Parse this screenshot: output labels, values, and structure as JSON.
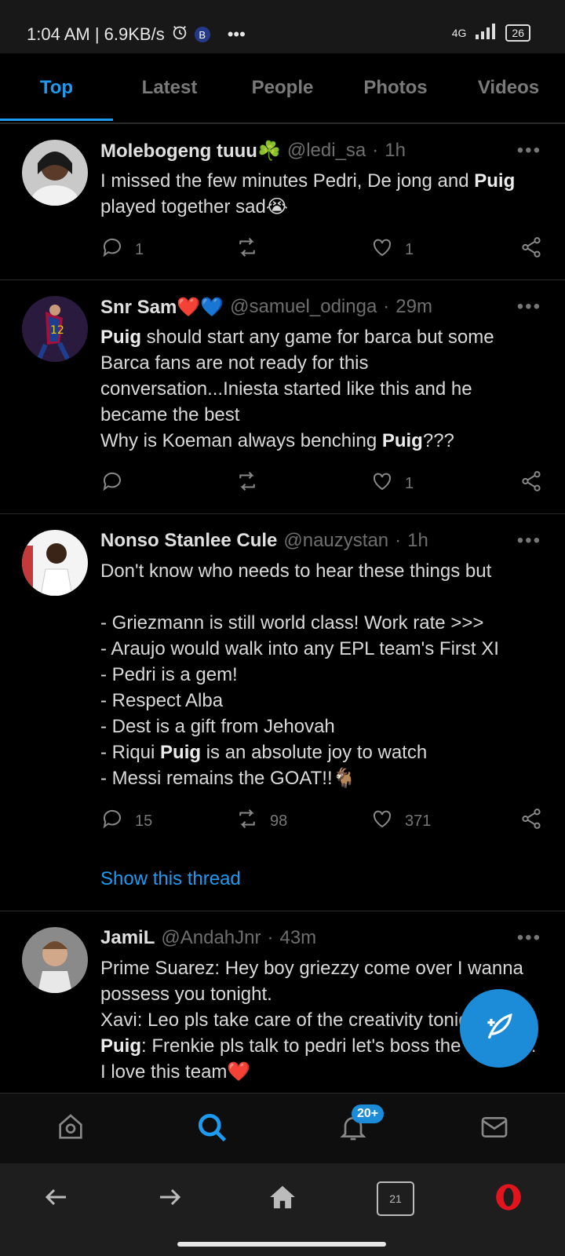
{
  "status_bar": {
    "time": "1:04 AM | 6.9KB/s",
    "more": "•••",
    "network": "4G",
    "battery": "26",
    "app_badge": "B"
  },
  "tabs": [
    {
      "label": "Top",
      "active": true
    },
    {
      "label": "Latest",
      "active": false
    },
    {
      "label": "People",
      "active": false
    },
    {
      "label": "Photos",
      "active": false
    },
    {
      "label": "Videos",
      "active": false
    }
  ],
  "tweets": [
    {
      "name": "Molebogeng tuuu☘️",
      "handle": "@ledi_sa",
      "time": "1h",
      "text_html": "I missed the few minutes Pedri, De jong and <b>Puig</b> played together sad😭",
      "replies": "1",
      "retweets": "",
      "likes": "1"
    },
    {
      "name": "Snr Sam❤️💙",
      "handle": "@samuel_odinga",
      "time": "29m",
      "text_html": "<b>Puig</b> should start any game for barca but some Barca fans are not ready for this conversation...Iniesta started like this and he became the best\nWhy is Koeman always benching <b>Puig</b>???",
      "replies": "",
      "retweets": "",
      "likes": "1"
    },
    {
      "name": "Nonso Stanlee Cule",
      "handle": "@nauzystan",
      "time": "1h",
      "text_html": "Don't know who needs to hear these things but\n\n- Griezmann is still world class! Work rate >>>\n- Araujo would walk into any EPL team's First XI\n- Pedri is a gem!\n- Respect Alba\n- Dest is a gift from Jehovah\n- Riqui <b>Puig</b> is an absolute joy to watch\n- Messi remains the GOAT!!🐐",
      "replies": "15",
      "retweets": "98",
      "likes": "371",
      "thread_link": "Show this thread"
    },
    {
      "name": "JamiL",
      "handle": "@AndahJnr",
      "time": "43m",
      "text_html": "Prime Suarez: Hey boy griezzy come over I wanna possess you tonight.\nXavi: Leo pls take care of the creativity tonight\n<b>Puig</b>: Frenkie pls talk to pedri let's boss the midfield.\nI love this team❤️",
      "replies": "",
      "retweets": "",
      "likes": ""
    }
  ],
  "bottom_nav": {
    "notifications_badge": "20+"
  },
  "browser_bar": {
    "tab_count": "21"
  },
  "colors": {
    "accent": "#1d9bf0",
    "background": "#000000"
  }
}
